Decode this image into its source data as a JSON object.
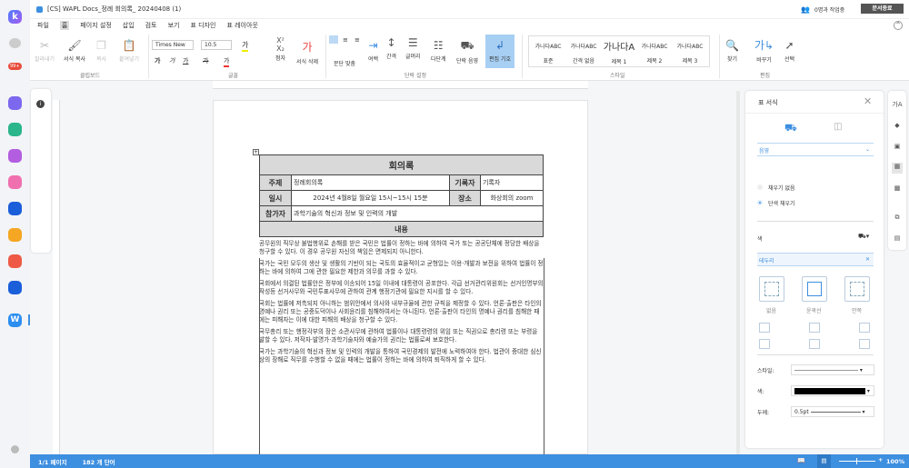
{
  "window": {
    "title": "[CS] WAPL Docs_정례 회의록_ 20240408 (1)",
    "collab": "0명과 작업중",
    "close_doc": "문서종료"
  },
  "rail": {
    "badge": "99+",
    "colors": [
      "#7b68ee",
      "#2bb58a",
      "#b35ee0",
      "#f06fae",
      "#1a5ed9",
      "#f5a623",
      "#ee5a45",
      "#1a5ed9",
      "#2d8ef0"
    ]
  },
  "menu": [
    "파일",
    "홈",
    "페이지 설정",
    "삽입",
    "검토",
    "보기",
    "표 디자인",
    "표 레이아웃"
  ],
  "ribbon": {
    "clipboard": {
      "cut": "잘라내기",
      "format_copy": "서식 복사",
      "copy": "복사",
      "paste": "붙여넣기",
      "label": "클립보드"
    },
    "font": {
      "name": "Times New",
      "size": "10.5",
      "label": "글꼴",
      "superscript": "첨자",
      "clear": "서식 삭제"
    },
    "paragraph": {
      "align": "문단 맞춤",
      "margin": "여백",
      "spacing": "간격",
      "bullets": "글머리",
      "multilevel": "다단계",
      "shade": "단락 음영",
      "marks": "편집 기호",
      "label": "단락 설정"
    },
    "styles": {
      "items": [
        {
          "sample": "가나다ABC",
          "name": "표준"
        },
        {
          "sample": "가나다ABC",
          "name": "간격 없음"
        },
        {
          "sample": "가나다A",
          "name": "제목 1"
        },
        {
          "sample": "가나다ABC",
          "name": "제목 2"
        },
        {
          "sample": "가나다ABC",
          "name": "제목 3"
        }
      ],
      "label": "스타일"
    },
    "edit": {
      "find": "찾기",
      "replace": "바꾸기",
      "select": "선택",
      "label": "편집"
    }
  },
  "document": {
    "title": "회의록",
    "subject_label": "주제",
    "subject": "정례회의록",
    "recorder_label": "기록자",
    "recorder": "기록자",
    "date_label": "일시",
    "date": "2024년 4월8일 월요일 15시~15시 15분",
    "place_label": "장소",
    "place": "화상회의 zoom",
    "attendees_label": "참가자",
    "attendees": "과학기술의 혁신과 정보 및 인력의 개발",
    "content_label": "내용",
    "paragraphs": [
      "공무원의 직무상 불법행위로 손해를 받은 국민은 법률이 정하는 바에 의하여 국가 또는 공공단체에 정당한 배상을 청구할 수 있다. 이 경우 공무원 자신의 책임은 면제되지 아니한다.",
      "국가는 국민 모두의 생산 및 생활의 기반이 되는 국토의 효율적이고 균형있는 이용·개발과 보전을 위하여 법률이 정하는 바에 의하여 그에 관한 필요한 제한과 의무를 과할 수 있다.",
      "국회에서 의결된 법률안은 정부에 이송되어 15일 이내에 대통령이 공포한다. 각급 선거관리위원회는 선거인명부의 작성등 선거사무와 국민투표사무에 관하여 관계 행정기관에 필요한 지시를 할 수 있다.",
      "국회는 법률에 저촉되지 아니하는 범위안에서 의사와 내부규율에 관한 규칙을 제정할 수 있다. 언론·출판은 타인의 명예나 권리 또는 공중도덕이나 사회윤리를 침해하여서는 아니된다. 언론·출판이 타인의 명예나 권리를 침해한 때에는 피해자는 이에 대한 피해의 배상을 청구할 수 있다.",
      "국무총리 또는 행정각부의 장은 소관사무에 관하여 법률이나 대통령령의 위임 또는 직권으로 총리령 또는 부령을 발할 수 있다. 저작자·발명가·과학기술자와 예술가의 권리는 법률로써 보호한다.",
      "국가는 과학기술의 혁신과 정보 및 인력의 개발을 통하여 국민경제의 발전에 노력하여야 한다. 법관이 중대한 심신상의 장해로 직무를 수행할 수 없을 때에는 법률이 정하는 바에 의하여 퇴직하게 할 수 있다."
    ]
  },
  "panel": {
    "title": "표 서식",
    "shade_section": "음영",
    "no_fill": "채우기 없음",
    "solid_fill": "단색 채우기",
    "fill_selected": "solid",
    "color_label": "색",
    "border_section": "테두리",
    "presets": [
      "없음",
      "윤곽선",
      "안쪽"
    ],
    "style_label": "스타일:",
    "color2_label": "색:",
    "width_label": "두께:",
    "width_value": "0.5pt"
  },
  "status": {
    "page": "1/1 페이지",
    "words": "182 개 단어",
    "zoom": "100%",
    "zoom_level": 100
  },
  "accent": "#3d8fe0"
}
